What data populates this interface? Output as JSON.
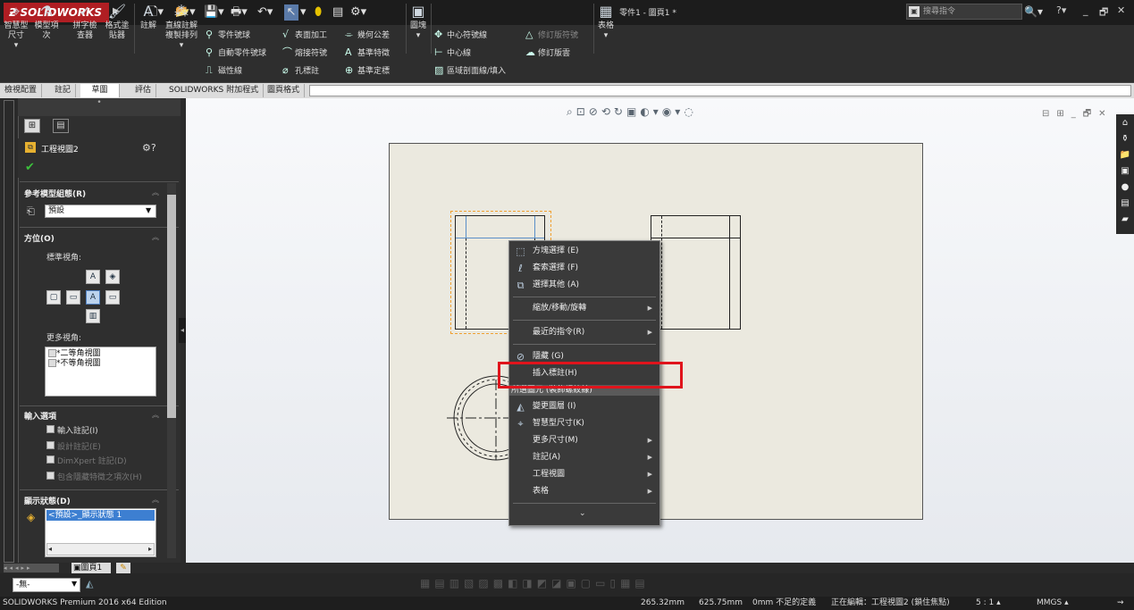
{
  "app": {
    "logo_text": "SOLIDWORKS",
    "doc_title": "零件1 - 圖頁1 *",
    "search_placeholder": "搜尋指令"
  },
  "ribbon": {
    "big_buttons": [
      {
        "label": "智慧型\n尺寸",
        "icon": "smart-dimension-icon"
      },
      {
        "label": "模型項\n次",
        "icon": "model-items-icon"
      },
      {
        "label": "拼字檢\n查器",
        "icon": "spell-checker-icon"
      },
      {
        "label": "格式塗\n貼器",
        "icon": "format-painter-icon"
      },
      {
        "label": "註解",
        "icon": "note-icon"
      },
      {
        "label": "直線註解\n複製排列",
        "icon": "linear-note-pattern-icon"
      }
    ],
    "col1": [
      "零件號球",
      "自動零件號球",
      "磁性線"
    ],
    "col2": [
      "表面加工",
      "熔接符號",
      "孔標註"
    ],
    "col3": [
      "幾何公差",
      "基準特徵",
      "基準定標"
    ],
    "block_label": "圖塊",
    "col4": [
      "中心符號線",
      "中心線",
      "區域剖面線/填入"
    ],
    "col5": [
      "修訂版符號",
      "修訂版雲"
    ],
    "table_label": "表格"
  },
  "tabs": [
    "檢視配置",
    "註記",
    "草圖",
    "評估",
    "SOLIDWORKS 附加程式",
    "圖頁格式"
  ],
  "panel": {
    "title": "工程視圖2",
    "sec_ref": "參考模型組態(R)",
    "ref_combo": "預設",
    "sec_orient": "方位(O)",
    "std_views": "標準視角:",
    "more_views": "更多視角:",
    "more_view_items": [
      "*二等角視圖",
      "*不等角視圖"
    ],
    "sec_import": "輸入選項",
    "import_items": [
      {
        "label": "輸入註記(I)",
        "on": true,
        "dim": false
      },
      {
        "label": "設計註記(E)",
        "on": false,
        "dim": true
      },
      {
        "label": "DimXpert 註記(D)",
        "on": false,
        "dim": true
      },
      {
        "label": "包含隱藏特徵之項次(H)",
        "on": false,
        "dim": true
      }
    ],
    "sec_display": "顯示狀態(D)",
    "display_item": "<預設>_顯示狀態 1"
  },
  "context_menu": {
    "items": [
      {
        "label": "方塊選擇 (E)",
        "icon": "box-select-icon"
      },
      {
        "label": "套索選擇 (F)",
        "icon": "lasso-select-icon"
      },
      {
        "label": "選擇其他 (A)",
        "icon": "select-other-icon"
      },
      {
        "label": "縮放/移動/旋轉",
        "icon": "",
        "sub": true
      },
      {
        "label": "最近的指令(R)",
        "icon": "",
        "sub": true
      },
      {
        "label": "隱藏 (G)",
        "icon": "hide-icon"
      },
      {
        "label": "插入標註(H)",
        "icon": ""
      },
      {
        "label": "變更圖層 (I)",
        "icon": "change-layer-icon"
      },
      {
        "label": "智慧型尺寸(K)",
        "icon": "smart-dimension-icon"
      },
      {
        "label": "更多尺寸(M)",
        "icon": "",
        "sub": true
      },
      {
        "label": "註記(A)",
        "icon": "",
        "sub": true
      },
      {
        "label": "工程視圖",
        "icon": "",
        "sub": true
      },
      {
        "label": "表格",
        "icon": "",
        "sub": true
      }
    ],
    "header": "所選圖元 (裝飾螺紋線)"
  },
  "sheet_tab": "圖頁1",
  "layer_combo": "-無-",
  "status": {
    "edition": "SOLIDWORKS Premium 2016 x64 Edition",
    "x": "265.32mm",
    "y": "625.75mm",
    "z": "0mm 不足的定義",
    "editing": "正在編輯：工程視圖2 (鎖住焦點)",
    "scale": "5 : 1",
    "units": "MMGS"
  },
  "colors": {
    "accent": "#b01e23",
    "highlight": "#e0141c",
    "selection": "#f0a030"
  }
}
